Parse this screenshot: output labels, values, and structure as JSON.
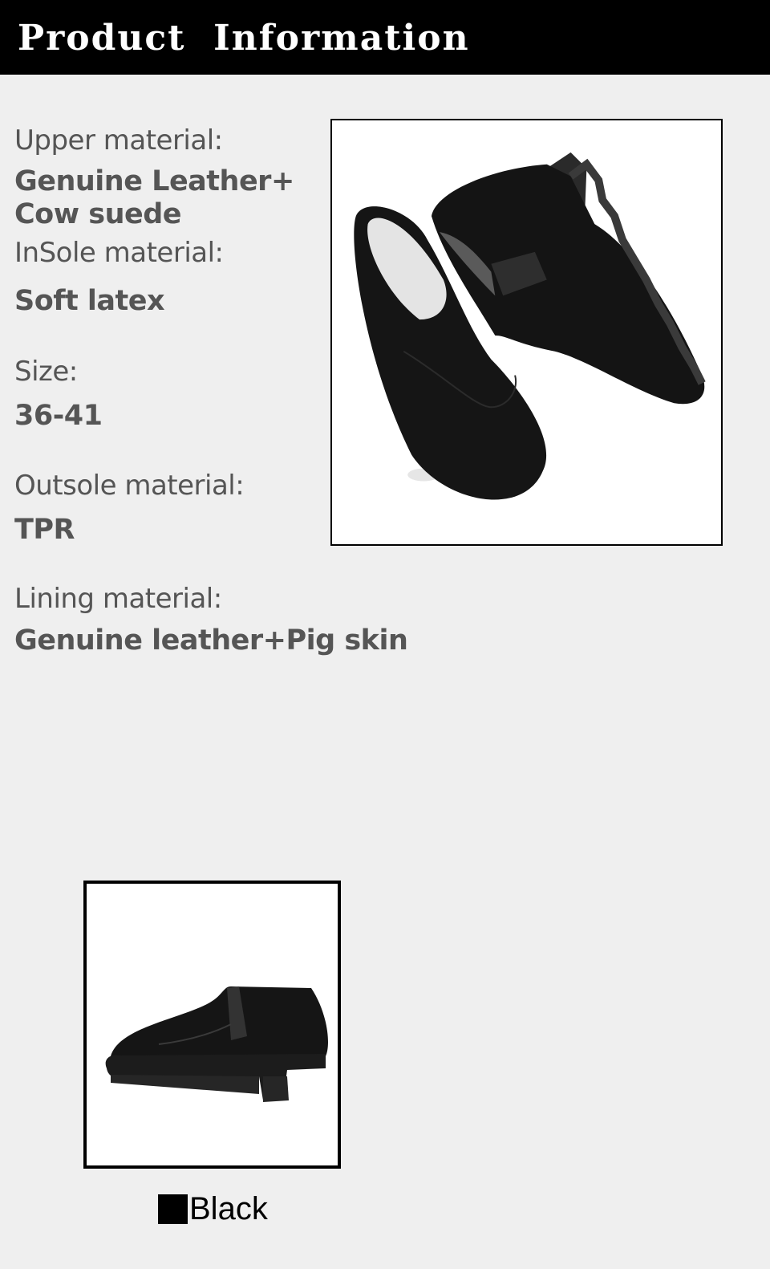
{
  "header": {
    "title": "Product  Information"
  },
  "specs": [
    {
      "label": "Upper material:",
      "value_lines": [
        "Genuine Leather+",
        "Cow suede"
      ]
    },
    {
      "label": "InSole material:",
      "value_lines": [
        "Soft latex"
      ]
    },
    {
      "label": "Size:",
      "value_lines": [
        "36-41"
      ]
    },
    {
      "label": "Outsole material:",
      "value_lines": [
        "TPR"
      ]
    },
    {
      "label": "Lining material:",
      "value_lines": [
        "Genuine leather+Pig skin"
      ]
    }
  ],
  "swatch": {
    "color_name": "Black",
    "color": "#000000"
  },
  "colors": {
    "header_bg": "#000000",
    "page_bg": "#efefef",
    "text": "#555555"
  }
}
